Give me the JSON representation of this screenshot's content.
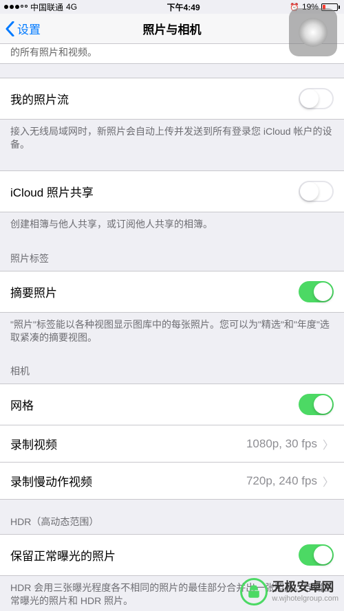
{
  "status": {
    "carrier": "中国联通",
    "network": "4G",
    "time": "下午4:49",
    "battery": "19%"
  },
  "nav": {
    "back": "设置",
    "title": "照片与相机"
  },
  "partial_row_text": "的所有照片和视频。",
  "sections": {
    "photo_stream": {
      "label": "我的照片流",
      "footer": "接入无线局域网时，新照片会自动上传并发送到所有登录您 iCloud 帐户的设备。"
    },
    "icloud_share": {
      "label": "iCloud 照片共享",
      "footer": "创建相簿与他人共享，或订阅他人共享的相簿。"
    },
    "photo_tab": {
      "header": "照片标签",
      "summary_label": "摘要照片",
      "footer": "\"照片\"标签能以各种视图显示图库中的每张照片。您可以为\"精选\"和\"年度\"选取紧凑的摘要视图。"
    },
    "camera": {
      "header": "相机",
      "grid_label": "网格",
      "record_video_label": "录制视频",
      "record_video_value": "1080p, 30 fps",
      "record_slomo_label": "录制慢动作视频",
      "record_slomo_value": "720p, 240 fps"
    },
    "hdr": {
      "header": "HDR（高动态范围）",
      "keep_normal_label": "保留正常曝光的照片",
      "footer": "HDR 会用三张曝光程度各不相同的照片的最佳部分合并出一张照片。存储正常曝光的照片和 HDR 照片。"
    }
  },
  "watermark": {
    "cn": "无极安卓网",
    "url": "w.wjhotelgroup.com"
  }
}
